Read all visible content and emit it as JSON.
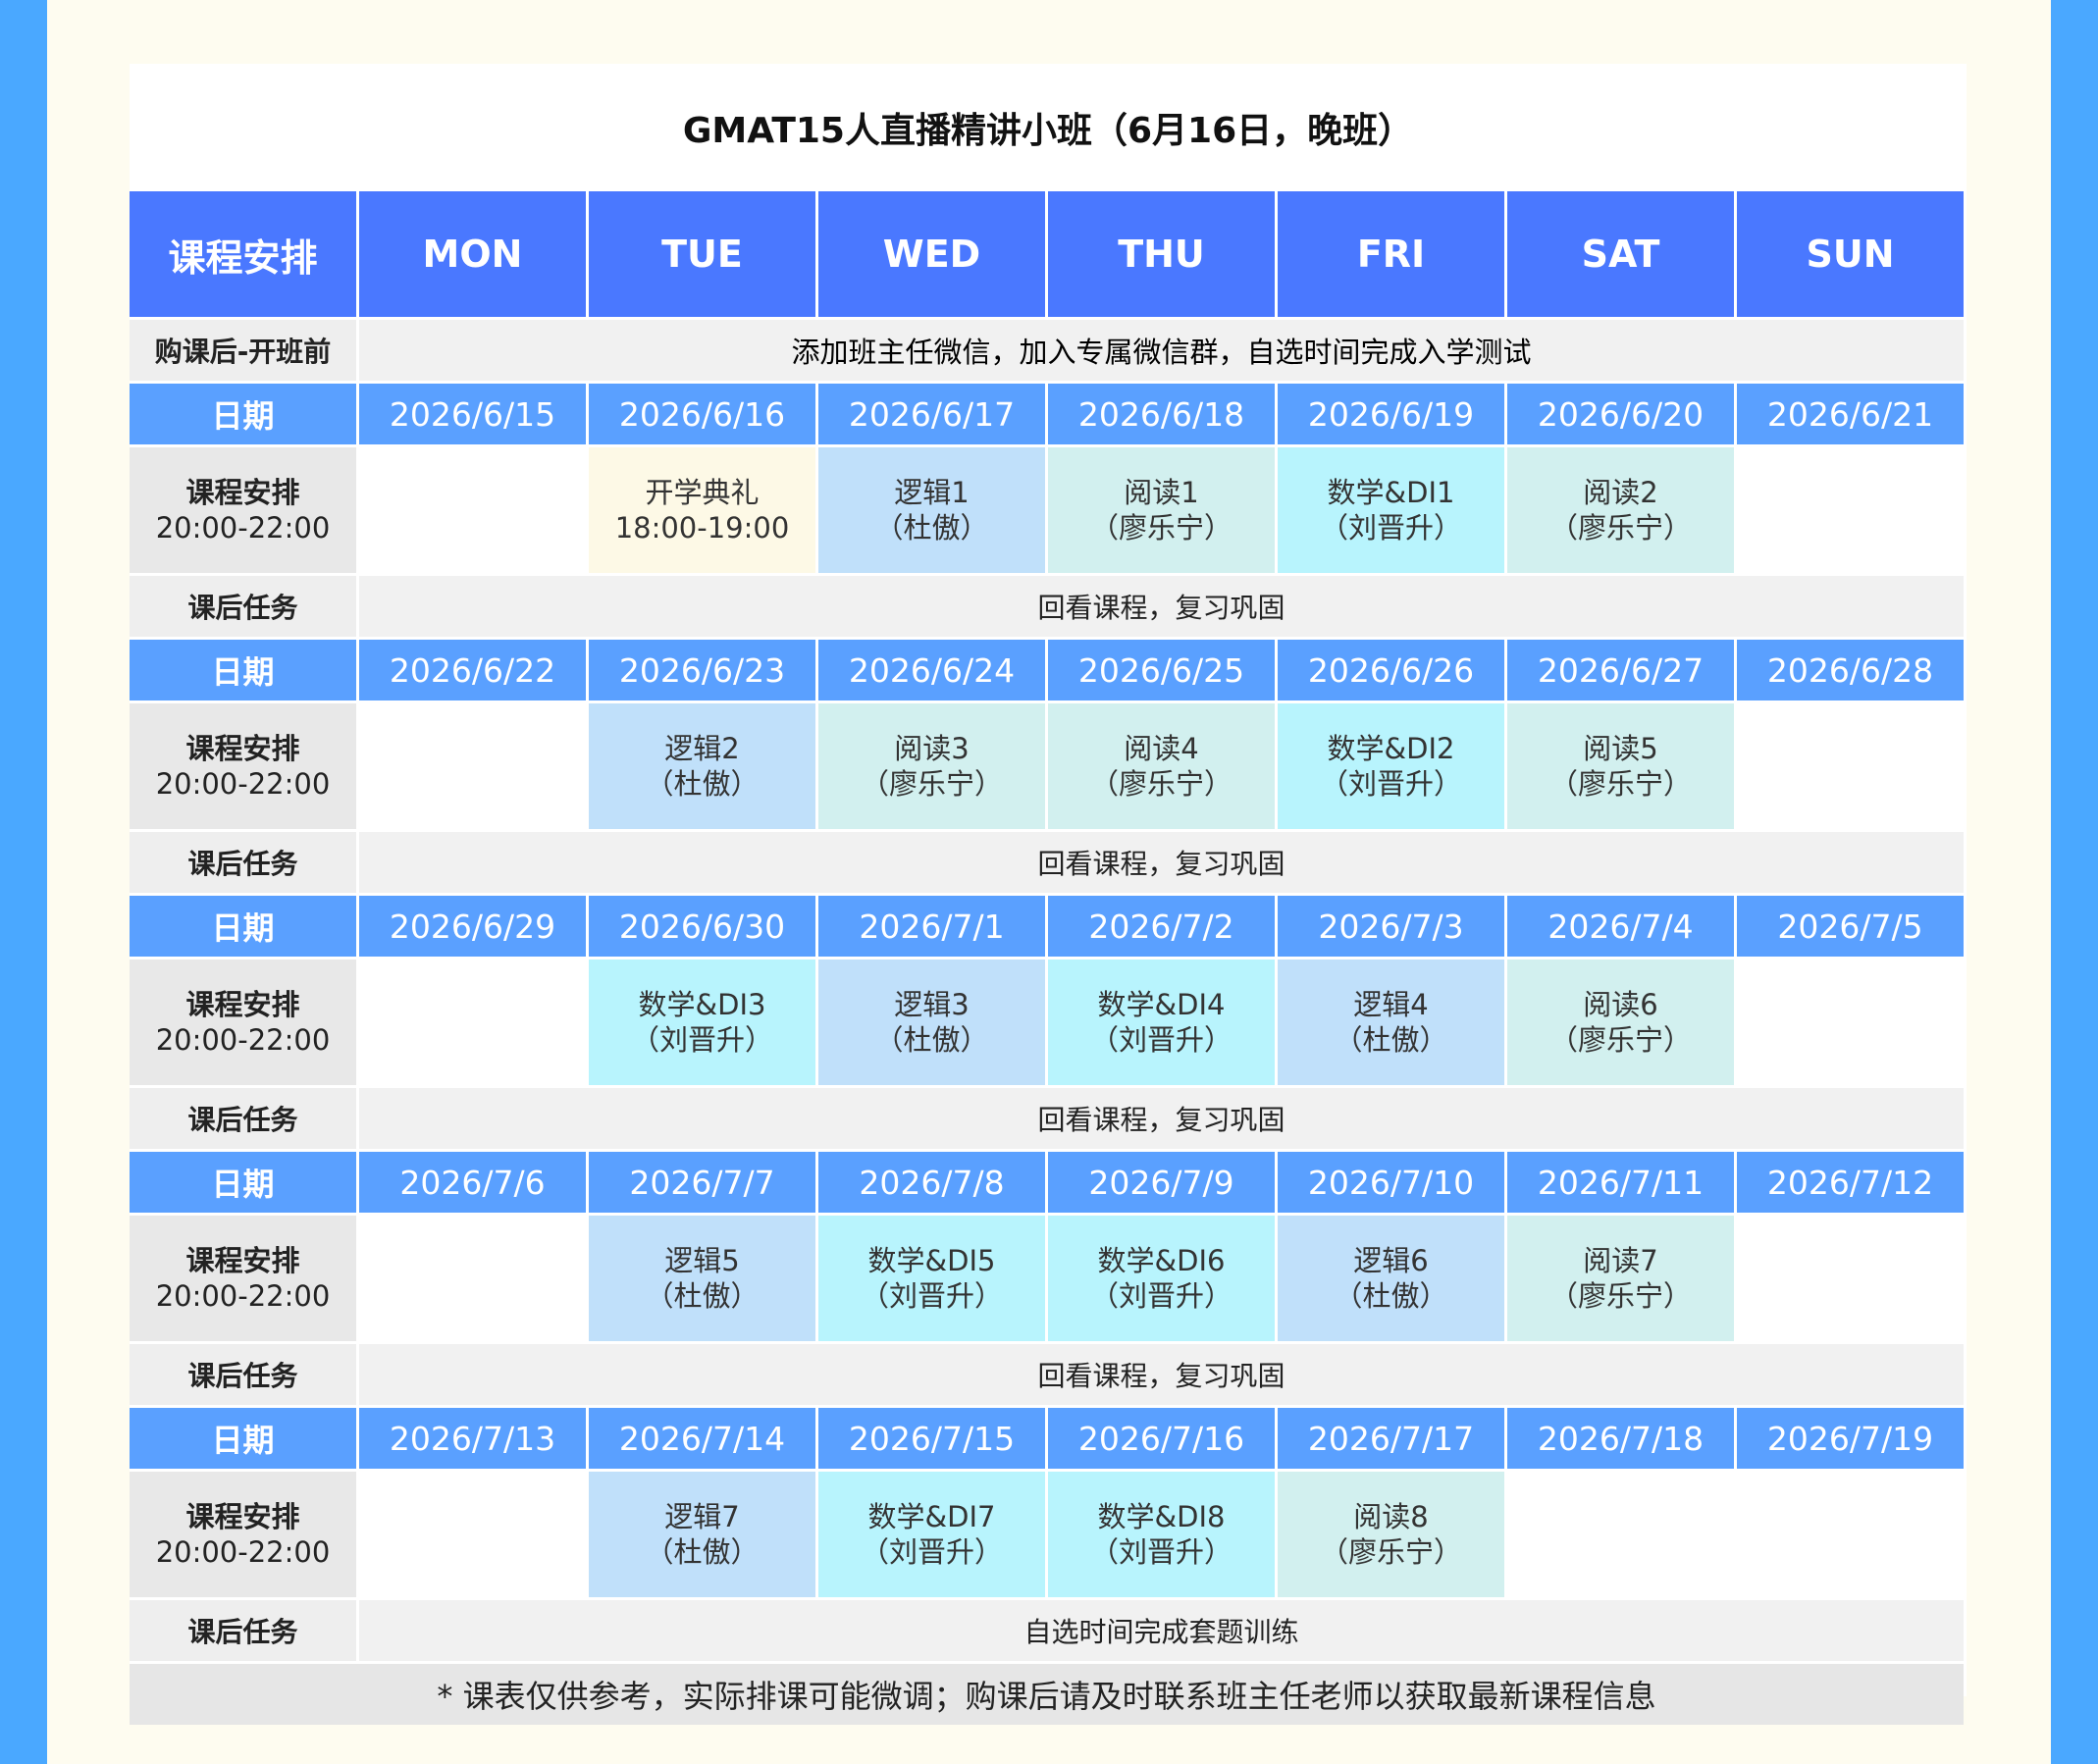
{
  "title": "GMAT15人直播精讲小班（6月16日，晚班）",
  "header": {
    "label": "课程安排",
    "days": [
      "MON",
      "TUE",
      "WED",
      "THU",
      "FRI",
      "SAT",
      "SUN"
    ]
  },
  "pre": {
    "label": "购课后-开班前",
    "text": "添加班主任微信，加入专属微信群，自选时间完成入学测试"
  },
  "labels": {
    "date": "日期",
    "class_title": "课程安排",
    "class_time": "20:00-22:00",
    "task": "课后任务"
  },
  "weeks": [
    {
      "dates": [
        "2026/6/15",
        "2026/6/16",
        "2026/6/17",
        "2026/6/18",
        "2026/6/19",
        "2026/6/20",
        "2026/6/21"
      ],
      "classes": [
        {
          "line1": "",
          "line2": "",
          "type": "empty"
        },
        {
          "line1": "开学典礼",
          "line2": "18:00-19:00",
          "type": "ceremony"
        },
        {
          "line1": "逻辑1",
          "line2": "（杜傲）",
          "type": "logic"
        },
        {
          "line1": "阅读1",
          "line2": "（廖乐宁）",
          "type": "read"
        },
        {
          "line1": "数学&DI1",
          "line2": "（刘晋升）",
          "type": "math"
        },
        {
          "line1": "阅读2",
          "line2": "（廖乐宁）",
          "type": "read"
        },
        {
          "line1": "",
          "line2": "",
          "type": "empty"
        }
      ],
      "task": "回看课程，复习巩固"
    },
    {
      "dates": [
        "2026/6/22",
        "2026/6/23",
        "2026/6/24",
        "2026/6/25",
        "2026/6/26",
        "2026/6/27",
        "2026/6/28"
      ],
      "classes": [
        {
          "line1": "",
          "line2": "",
          "type": "empty"
        },
        {
          "line1": "逻辑2",
          "line2": "（杜傲）",
          "type": "logic"
        },
        {
          "line1": "阅读3",
          "line2": "（廖乐宁）",
          "type": "read"
        },
        {
          "line1": "阅读4",
          "line2": "（廖乐宁）",
          "type": "read"
        },
        {
          "line1": "数学&DI2",
          "line2": "（刘晋升）",
          "type": "math"
        },
        {
          "line1": "阅读5",
          "line2": "（廖乐宁）",
          "type": "read"
        },
        {
          "line1": "",
          "line2": "",
          "type": "empty"
        }
      ],
      "task": "回看课程，复习巩固"
    },
    {
      "dates": [
        "2026/6/29",
        "2026/6/30",
        "2026/7/1",
        "2026/7/2",
        "2026/7/3",
        "2026/7/4",
        "2026/7/5"
      ],
      "classes": [
        {
          "line1": "",
          "line2": "",
          "type": "empty"
        },
        {
          "line1": "数学&DI3",
          "line2": "（刘晋升）",
          "type": "math"
        },
        {
          "line1": "逻辑3",
          "line2": "（杜傲）",
          "type": "logic"
        },
        {
          "line1": "数学&DI4",
          "line2": "（刘晋升）",
          "type": "math"
        },
        {
          "line1": "逻辑4",
          "line2": "（杜傲）",
          "type": "logic"
        },
        {
          "line1": "阅读6",
          "line2": "（廖乐宁）",
          "type": "read"
        },
        {
          "line1": "",
          "line2": "",
          "type": "empty"
        }
      ],
      "task": "回看课程，复习巩固"
    },
    {
      "dates": [
        "2026/7/6",
        "2026/7/7",
        "2026/7/8",
        "2026/7/9",
        "2026/7/10",
        "2026/7/11",
        "2026/7/12"
      ],
      "classes": [
        {
          "line1": "",
          "line2": "",
          "type": "empty"
        },
        {
          "line1": "逻辑5",
          "line2": "（杜傲）",
          "type": "logic"
        },
        {
          "line1": "数学&DI5",
          "line2": "（刘晋升）",
          "type": "math"
        },
        {
          "line1": "数学&DI6",
          "line2": "（刘晋升）",
          "type": "math"
        },
        {
          "line1": "逻辑6",
          "line2": "（杜傲）",
          "type": "logic"
        },
        {
          "line1": "阅读7",
          "line2": "（廖乐宁）",
          "type": "read"
        },
        {
          "line1": "",
          "line2": "",
          "type": "empty"
        }
      ],
      "task": "回看课程，复习巩固"
    },
    {
      "dates": [
        "2026/7/13",
        "2026/7/14",
        "2026/7/15",
        "2026/7/16",
        "2026/7/17",
        "2026/7/18",
        "2026/7/19"
      ],
      "classes": [
        {
          "line1": "",
          "line2": "",
          "type": "empty"
        },
        {
          "line1": "逻辑7",
          "line2": "（杜傲）",
          "type": "logic"
        },
        {
          "line1": "数学&DI7",
          "line2": "（刘晋升）",
          "type": "math"
        },
        {
          "line1": "数学&DI8",
          "line2": "（刘晋升）",
          "type": "math"
        },
        {
          "line1": "阅读8",
          "line2": "（廖乐宁）",
          "type": "read"
        },
        {
          "line1": "",
          "line2": "",
          "type": "empty"
        },
        {
          "line1": "",
          "line2": "",
          "type": "empty"
        }
      ],
      "task": "自选时间完成套题训练"
    }
  ],
  "note": "* 课表仅供参考，实际排课可能微调；购课后请及时联系班主任老师以获取最新课程信息",
  "colors": {
    "side_bar": "#4aa8ff",
    "header": "#4a78ff",
    "date_row": "#5aa0ff",
    "ceremony": "#fdf9e6",
    "logic": "#c0e0fa",
    "read": "#d2f0ef",
    "math": "#b8f4fd"
  }
}
